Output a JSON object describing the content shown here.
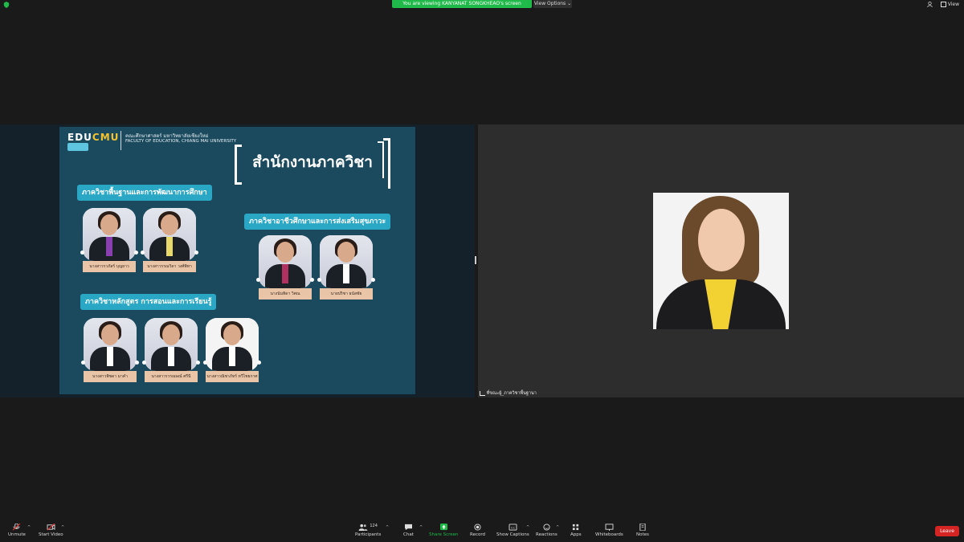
{
  "topbar": {
    "banner": "You are viewing KANYANAT SONGKHEAO's screen",
    "view_options": "View Options ⌄",
    "view_label": "View"
  },
  "slide": {
    "logo_left": "EDU",
    "logo_right": "CMU",
    "faculty_th": "คณะศึกษาศาสตร์ มหาวิทยาลัยเชียงใหม่",
    "faculty_en": "FACULTY OF EDUCATION, CHIANG MAI UNIVERSITY",
    "title": "สำนักงานภาควิชา",
    "departments": [
      {
        "name": "ภาควิชาพื้นฐานและการพัฒนาการศึกษา",
        "people": [
          "นางสาวรวภัสร์ บุญยาว",
          "นางสาวรรณวิดา วงศ์พิทา"
        ]
      },
      {
        "name": "ภาควิชาอาชีวศึกษาและการส่งเสริมสุขภาวะ",
        "people": [
          "นางนันทิดา วิศณ",
          "นายปริชา ธนัสชัย"
        ]
      },
      {
        "name": "ภาควิชาหลักสูตร การสอนและการเรียนรู้",
        "people": [
          "นางสาวพิชดา มาคำ",
          "นางสาวรวรณษณ์ ศรีนี",
          "นางสาวณิชาภัทร์ ทวีไชยกาศ"
        ]
      }
    ]
  },
  "video": {
    "participant_label": "ที่ขณะผู้_ภาควิชาพื้นฐานา"
  },
  "toolbar": {
    "unmute": "Unmute",
    "start_video": "Start Video",
    "participants": "Participants",
    "participants_count": "124",
    "chat": "Chat",
    "share_screen": "Share Screen",
    "record": "Record",
    "show_captions": "Show Captions",
    "reactions": "Reactions",
    "apps": "Apps",
    "whiteboards": "Whiteboards",
    "notes": "Notes",
    "leave": "Leave"
  },
  "colors": {
    "banner_green": "#1fba49",
    "leave_red": "#d52424",
    "slide_bg": "#1b4a5e",
    "dept_tag": "#2aa7c5",
    "name_tag": "#e9c4a6"
  }
}
